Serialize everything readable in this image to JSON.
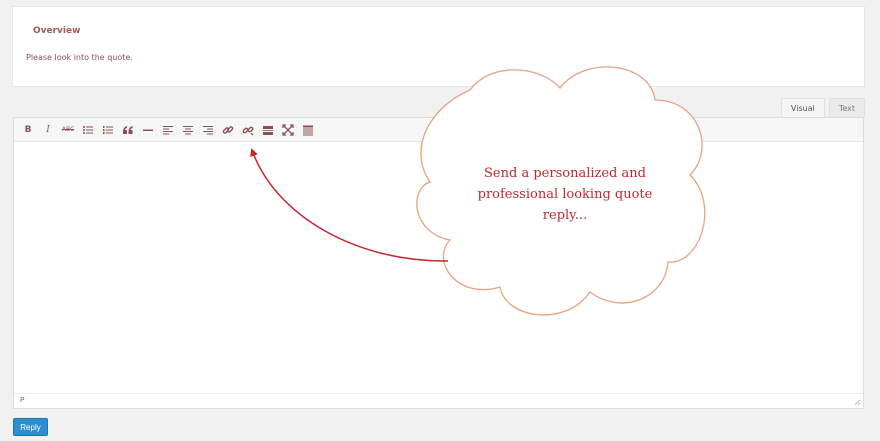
{
  "overview": {
    "title": "Overview",
    "text": "Please look into the quote."
  },
  "tabs": [
    {
      "label": "Visual",
      "active": true
    },
    {
      "label": "Text",
      "active": false
    }
  ],
  "toolbar": {
    "bold": "B",
    "italic": "I",
    "strike": "ABC",
    "icons": [
      "bold-icon",
      "italic-icon",
      "strikethrough-icon",
      "bullet-list-icon",
      "numbered-list-icon",
      "blockquote-icon",
      "horizontal-rule-icon",
      "align-left-icon",
      "align-center-icon",
      "align-right-icon",
      "link-icon",
      "unlink-icon",
      "read-more-icon",
      "fullscreen-icon",
      "toolbar-toggle-icon"
    ]
  },
  "editor": {
    "status_path": "P"
  },
  "reply_button": "Reply",
  "callout": {
    "text": "Send a personalized and professional looking quote reply...",
    "color": "#c0292b",
    "cloud_stroke": "#e7a37f"
  }
}
